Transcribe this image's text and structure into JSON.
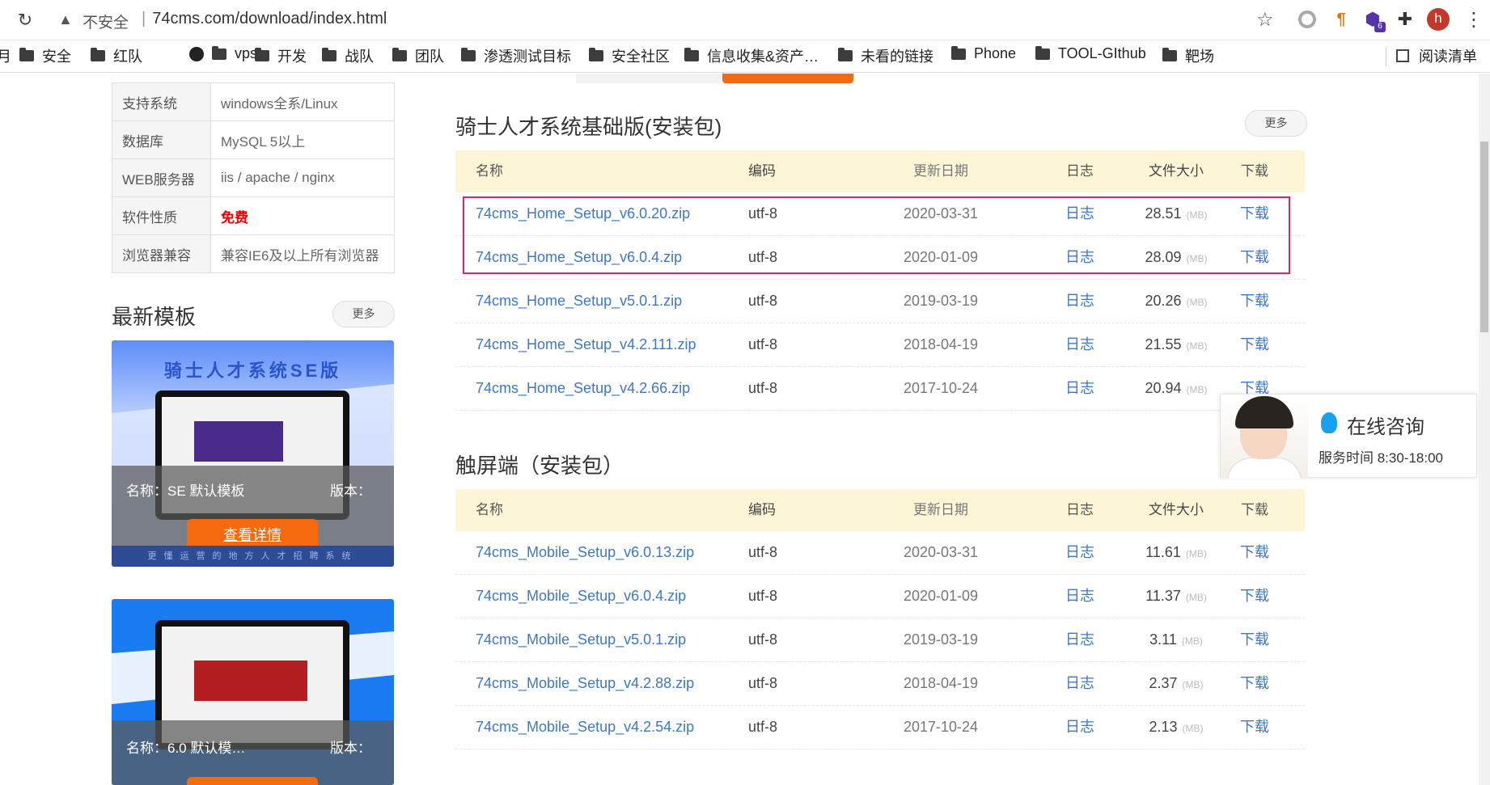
{
  "browser": {
    "insecure_label": "不安全",
    "url": "74cms.com/download/index.html",
    "extension_badge": "6",
    "avatar_letter": "h"
  },
  "bookmarks": {
    "items": [
      "安全",
      "红队",
      "vps",
      "开发",
      "战队",
      "团队",
      "渗透测试目标",
      "安全社区",
      "信息收集&资产…",
      "未看的链接",
      "Phone",
      "TOOL-GIthub",
      "靶场"
    ],
    "reading_list": "阅读清单"
  },
  "info": {
    "rows": [
      {
        "k": "支持系统",
        "v": "windows全系/Linux"
      },
      {
        "k": "数据库",
        "v": "MySQL 5以上"
      },
      {
        "k": "WEB服务器",
        "v": "iis / apache / nginx"
      },
      {
        "k": "软件性质",
        "v": "免费"
      },
      {
        "k": "浏览器兼容",
        "v": "兼容IE6及以上所有浏览器"
      }
    ]
  },
  "templates": {
    "title": "最新模板",
    "more": "更多",
    "card1": {
      "banner": "骑士人才系统SE版",
      "name": "名称：SE 默认模板",
      "version": "版本：",
      "detail": "查看详情",
      "footer": "更懂运营的地方人才招聘系统"
    },
    "card2": {
      "name": "名称：6.0 默认模…",
      "version": "版本："
    }
  },
  "columns": {
    "name": "名称",
    "enc": "编码",
    "date": "更新日期",
    "log": "日志",
    "size": "文件大小",
    "dl": "下载"
  },
  "home": {
    "title": "骑士人才系统基础版(安装包)",
    "more": "更多",
    "rows": [
      {
        "name": "74cms_Home_Setup_v6.0.20.zip",
        "enc": "utf-8",
        "date": "2020-03-31",
        "log": "日志",
        "size": "28.51",
        "unit": "(MB)",
        "dl": "下载"
      },
      {
        "name": "74cms_Home_Setup_v6.0.4.zip",
        "enc": "utf-8",
        "date": "2020-01-09",
        "log": "日志",
        "size": "28.09",
        "unit": "(MB)",
        "dl": "下载"
      },
      {
        "name": "74cms_Home_Setup_v5.0.1.zip",
        "enc": "utf-8",
        "date": "2019-03-19",
        "log": "日志",
        "size": "20.26",
        "unit": "(MB)",
        "dl": "下载"
      },
      {
        "name": "74cms_Home_Setup_v4.2.111.zip",
        "enc": "utf-8",
        "date": "2018-04-19",
        "log": "日志",
        "size": "21.55",
        "unit": "(MB)",
        "dl": "下载"
      },
      {
        "name": "74cms_Home_Setup_v4.2.66.zip",
        "enc": "utf-8",
        "date": "2017-10-24",
        "log": "日志",
        "size": "20.94",
        "unit": "(MB)",
        "dl": "下载"
      }
    ]
  },
  "mobile": {
    "title": "触屏端（安装包）",
    "rows": [
      {
        "name": "74cms_Mobile_Setup_v6.0.13.zip",
        "enc": "utf-8",
        "date": "2020-03-31",
        "log": "日志",
        "size": "11.61",
        "unit": "(MB)",
        "dl": "下载"
      },
      {
        "name": "74cms_Mobile_Setup_v6.0.4.zip",
        "enc": "utf-8",
        "date": "2020-01-09",
        "log": "日志",
        "size": "11.37",
        "unit": "(MB)",
        "dl": "下载"
      },
      {
        "name": "74cms_Mobile_Setup_v5.0.1.zip",
        "enc": "utf-8",
        "date": "2019-03-19",
        "log": "日志",
        "size": "3.11",
        "unit": "(MB)",
        "dl": "下载"
      },
      {
        "name": "74cms_Mobile_Setup_v4.2.88.zip",
        "enc": "utf-8",
        "date": "2018-04-19",
        "log": "日志",
        "size": "2.37",
        "unit": "(MB)",
        "dl": "下载"
      },
      {
        "name": "74cms_Mobile_Setup_v4.2.54.zip",
        "enc": "utf-8",
        "date": "2017-10-24",
        "log": "日志",
        "size": "2.13",
        "unit": "(MB)",
        "dl": "下载"
      }
    ]
  },
  "consult": {
    "title": "在线咨询",
    "time": "服务时间 8:30-18:00"
  },
  "colors": {
    "accent": "#f5690f",
    "link": "#3d78c8",
    "highlight_box": "#e0245e",
    "table_head_bg": "#fdf6d6"
  }
}
